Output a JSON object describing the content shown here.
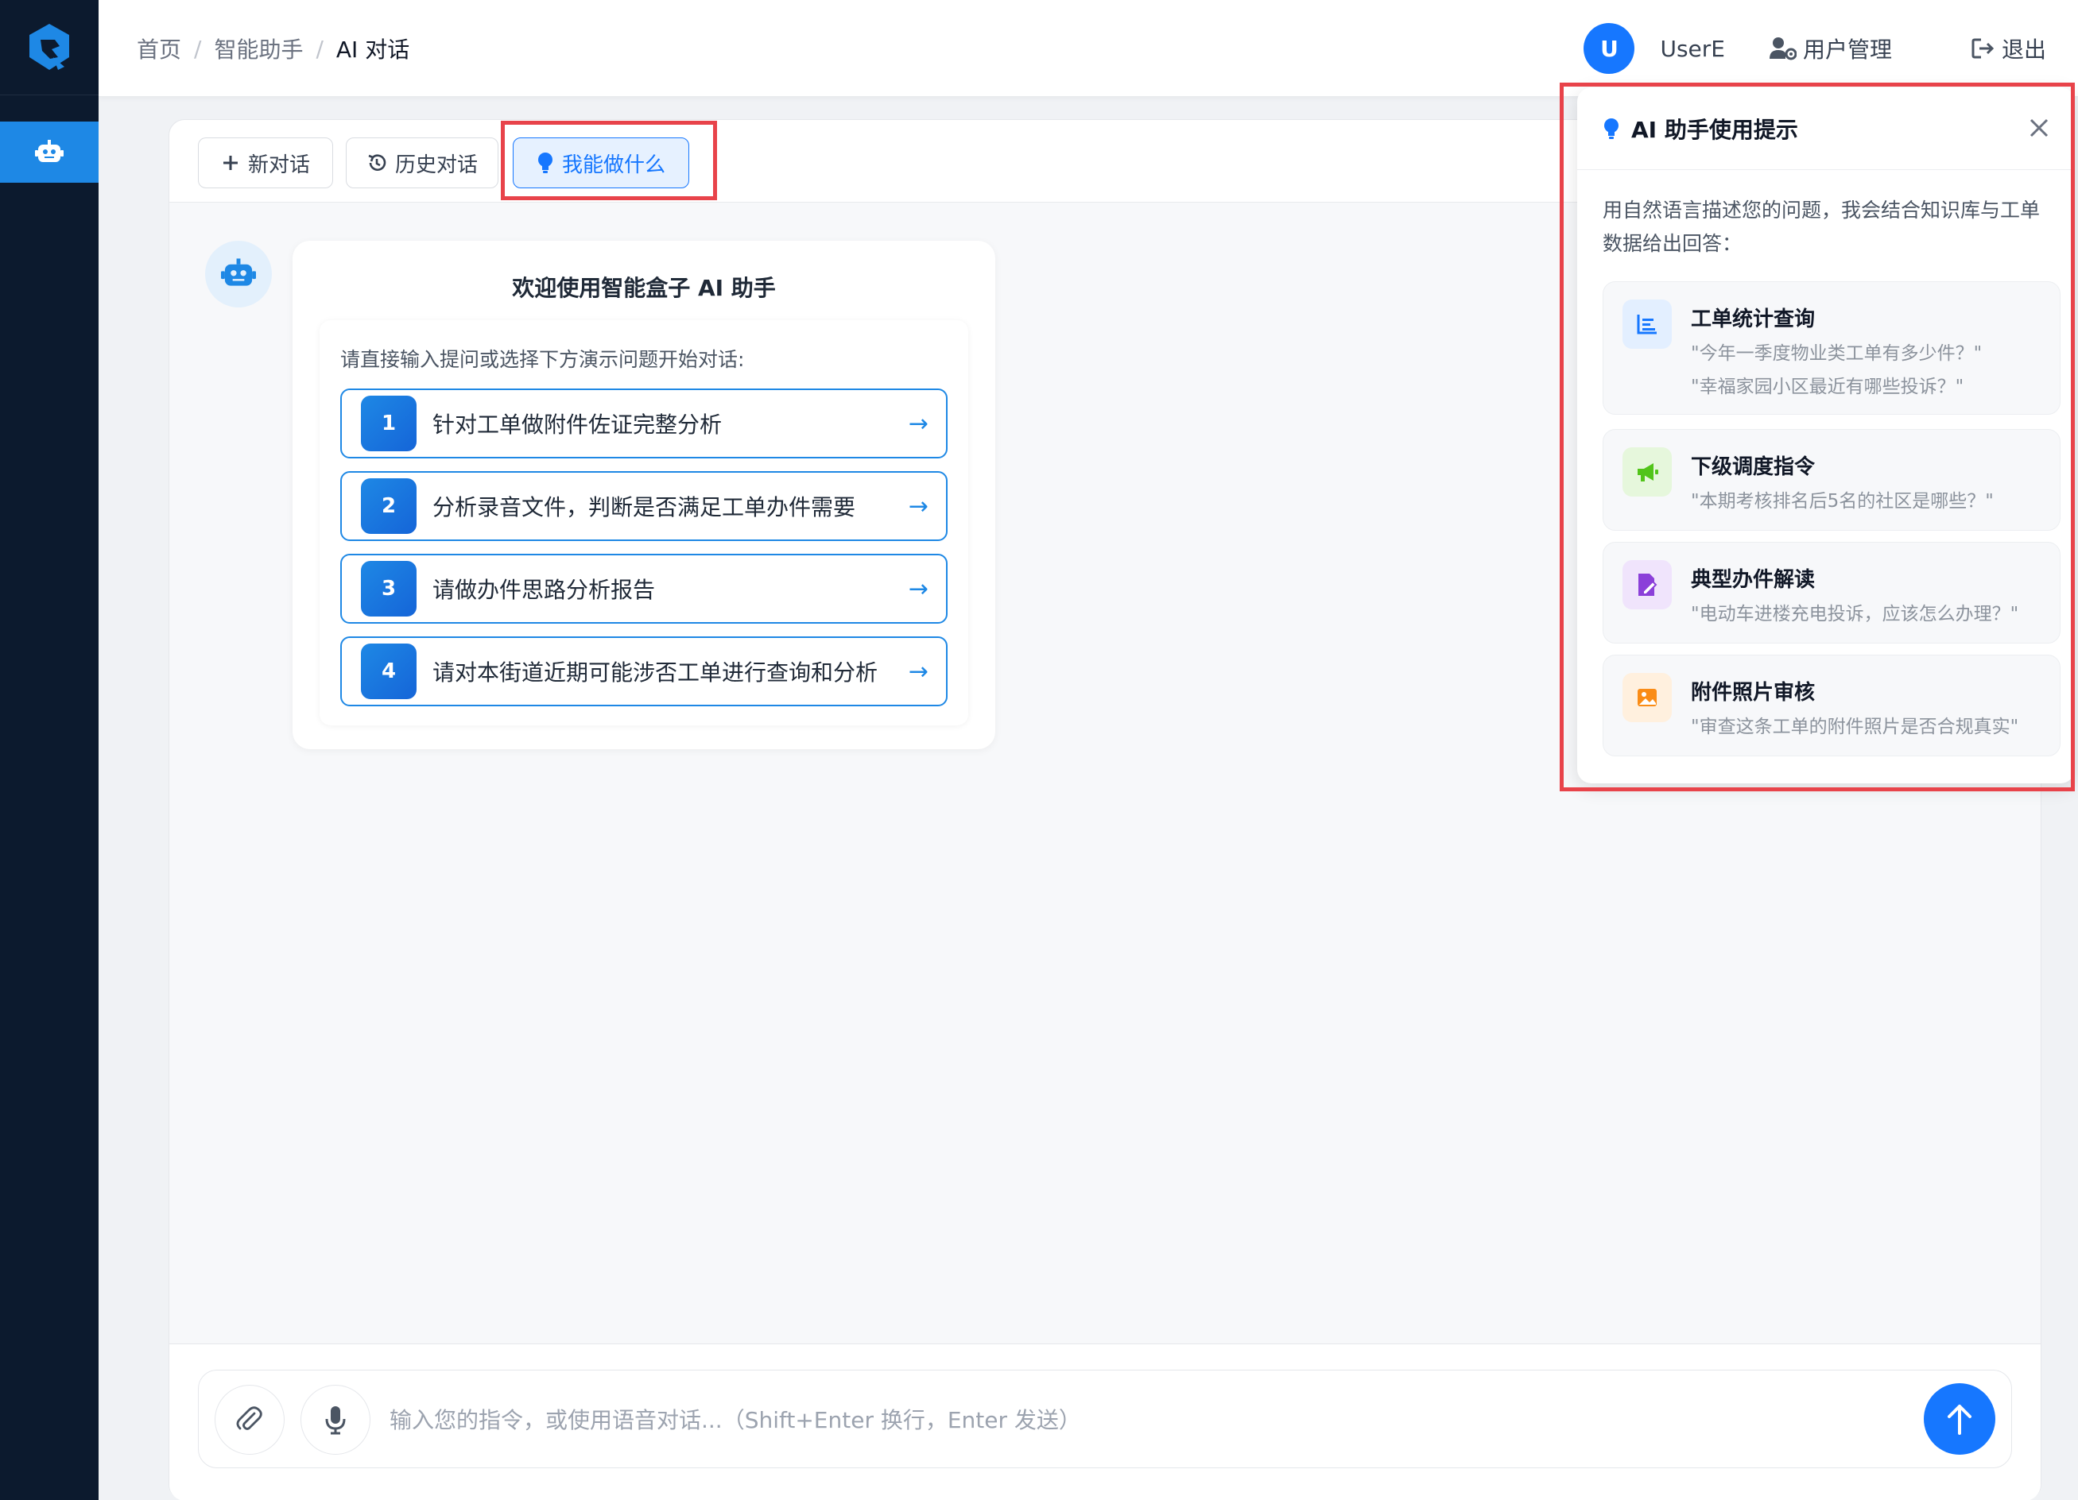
{
  "header": {
    "breadcrumb": [
      "首页",
      "智能助手",
      "AI 对话"
    ],
    "avatar_letter": "U",
    "username": "UserE",
    "user_mgmt": "用户管理",
    "logout": "退出"
  },
  "toolbar": {
    "new_chat": "新对话",
    "history": "历史对话",
    "capabilities": "我能做什么"
  },
  "welcome": {
    "title": "欢迎使用智能盒子 AI 助手",
    "hint": "请直接输入提问或选择下方演示问题开始对话:",
    "questions": [
      {
        "num": "1",
        "text": "针对工单做附件佐证完整分析",
        "arrow": "→"
      },
      {
        "num": "2",
        "text": "分析录音文件，判断是否满足工单办件需要",
        "arrow": "→"
      },
      {
        "num": "3",
        "text": "请做办件思路分析报告",
        "arrow": "→"
      },
      {
        "num": "4",
        "text": "请对本街道近期可能涉否工单进行查询和分析",
        "arrow": "→"
      }
    ]
  },
  "input": {
    "placeholder": "输入您的指令，或使用语音对话...（Shift+Enter 换行，Enter 发送）"
  },
  "tips": {
    "title": "AI 助手使用提示",
    "desc": "用自然语言描述您的问题，我会结合知识库与工单数据给出回答：",
    "cards": [
      {
        "title": "工单统计查询",
        "examples": [
          "\"今年一季度物业类工单有多少件？\"",
          "\"幸福家园小区最近有哪些投诉？\""
        ],
        "icon": "chart-icon",
        "color": "#1677ff"
      },
      {
        "title": "下级调度指令",
        "examples": [
          "\"本期考核排名后5名的社区是哪些？\""
        ],
        "icon": "megaphone-icon",
        "color": "#52c41a"
      },
      {
        "title": "典型办件解读",
        "examples": [
          "\"电动车进楼充电投诉，应该怎么办理？\""
        ],
        "icon": "document-edit-icon",
        "color": "#8b3fd9"
      },
      {
        "title": "附件照片审核",
        "examples": [
          "\"审查这条工单的附件照片是否合规真实\""
        ],
        "icon": "image-icon",
        "color": "#fa8c16"
      }
    ]
  },
  "colors": {
    "accent": "#1677ff",
    "sidebar": "#0c1a2e",
    "highlight": "#e8434a"
  }
}
